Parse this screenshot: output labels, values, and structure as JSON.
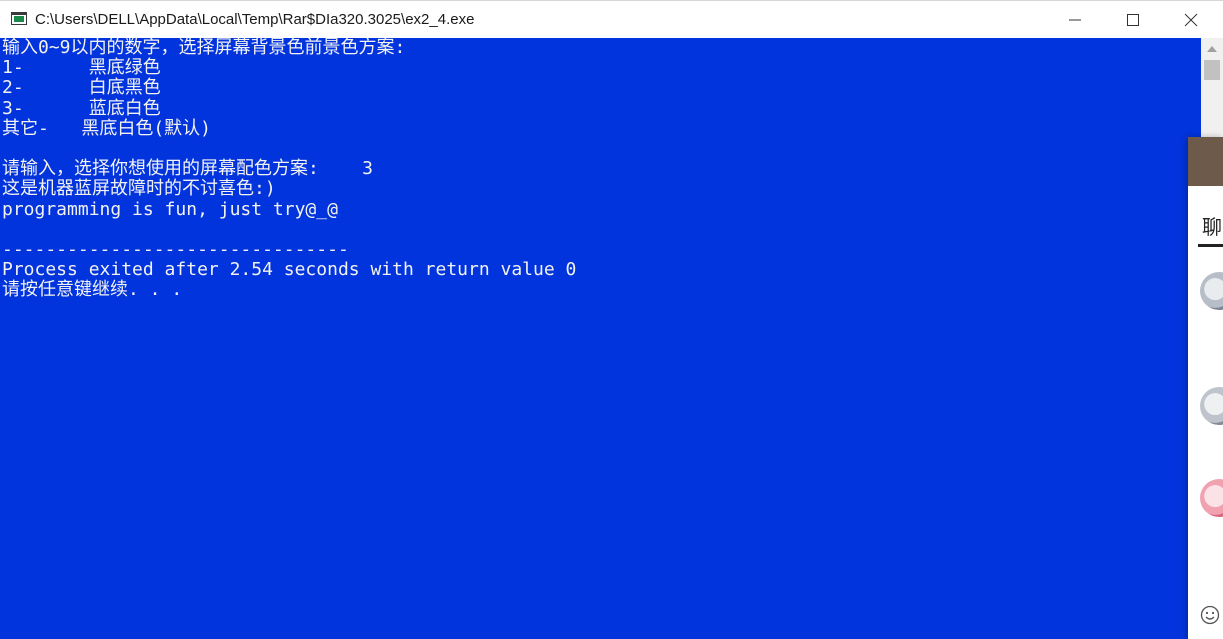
{
  "window": {
    "title": "C:\\Users\\DELL\\AppData\\Local\\Temp\\Rar$DIa320.3025\\ex2_4.exe",
    "minimize_icon": "minimize-icon",
    "maximize_icon": "maximize-icon",
    "close_icon": "close-icon"
  },
  "console": {
    "background_color": "#0134dd",
    "text_color": "#f2f2f2",
    "lines": [
      "输入0~9以内的数字，选择屏幕背景色前景色方案:",
      "1-      黑底绿色",
      "2-      白底黑色",
      "3-      蓝底白色",
      "其它-   黑底白色(默认)",
      "",
      "请输入，选择你想使用的屏幕配色方案:    3",
      "这是机器蓝屏故障时的不讨喜色:)",
      "programming is fun, just try@_@",
      "",
      "--------------------------------",
      "Process exited after 2.54 seconds with return value 0",
      "请按任意键继续. . ."
    ]
  },
  "side_panel": {
    "tab_label": "聊",
    "emoji_icon": "emoji-icon",
    "avatars": [
      "avatar",
      "avatar",
      "avatar"
    ]
  }
}
